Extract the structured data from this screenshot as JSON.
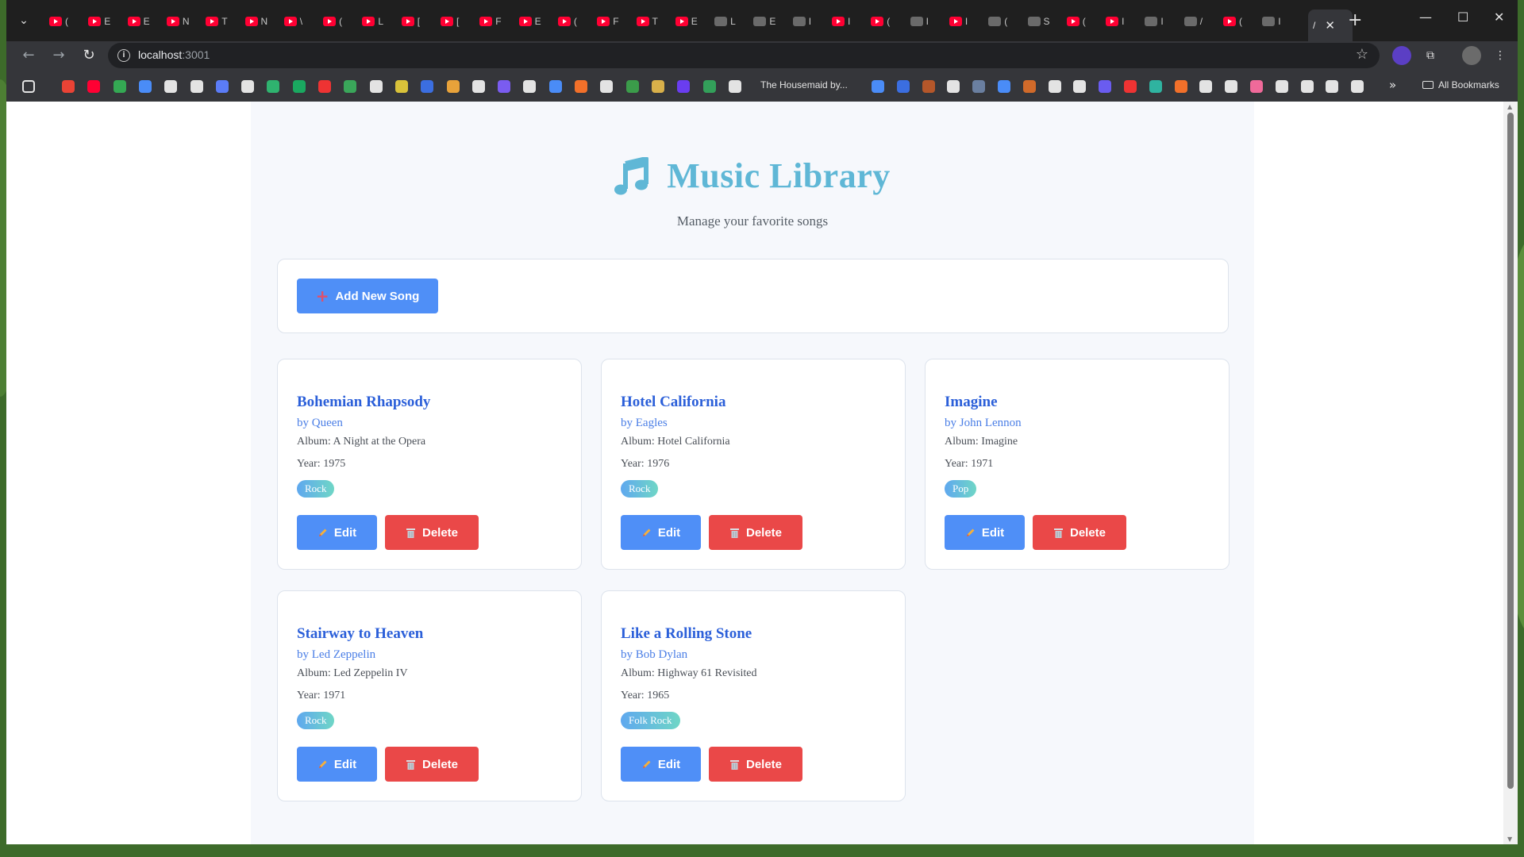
{
  "browser": {
    "tabs": [
      {
        "text": "(",
        "kind": "youtube"
      },
      {
        "text": "E",
        "kind": "youtube"
      },
      {
        "text": "E",
        "kind": "youtube"
      },
      {
        "text": "N",
        "kind": "youtube"
      },
      {
        "text": "T",
        "kind": "youtube"
      },
      {
        "text": "N",
        "kind": "youtube"
      },
      {
        "text": "\\",
        "kind": "youtube"
      },
      {
        "text": "(",
        "kind": "youtube"
      },
      {
        "text": "L",
        "kind": "youtube"
      },
      {
        "text": "[",
        "kind": "youtube"
      },
      {
        "text": "[",
        "kind": "youtube"
      },
      {
        "text": "F",
        "kind": "youtube"
      },
      {
        "text": "E",
        "kind": "youtube"
      },
      {
        "text": "(",
        "kind": "youtube"
      },
      {
        "text": "F",
        "kind": "youtube"
      },
      {
        "text": "T",
        "kind": "youtube"
      },
      {
        "text": "E",
        "kind": "youtube"
      },
      {
        "text": "L",
        "kind": "site"
      },
      {
        "text": "E",
        "kind": "site"
      },
      {
        "text": "I",
        "kind": "site"
      },
      {
        "text": "I",
        "kind": "youtube"
      },
      {
        "text": "(",
        "kind": "youtube"
      },
      {
        "text": "I",
        "kind": "site"
      },
      {
        "text": "I",
        "kind": "youtube"
      },
      {
        "text": "(",
        "kind": "site"
      },
      {
        "text": "S",
        "kind": "site"
      },
      {
        "text": "(",
        "kind": "youtube"
      },
      {
        "text": "I",
        "kind": "youtube"
      },
      {
        "text": "I",
        "kind": "site"
      },
      {
        "text": "/",
        "kind": "site"
      },
      {
        "text": "(",
        "kind": "youtube"
      },
      {
        "text": "I",
        "kind": "site"
      }
    ],
    "active_tab": {
      "text": "/",
      "close": "✕"
    },
    "new_tab": "+",
    "window_controls": {
      "minimize": "—",
      "maximize": "☐",
      "close": "✕"
    },
    "url_host": "localhost",
    "url_port": ":3001",
    "bookmark_text": "The Housemaid by...",
    "bookmarks_more": "»",
    "all_bookmarks": "All Bookmarks"
  },
  "app": {
    "title": "Music Library",
    "subtitle": "Manage your favorite songs",
    "add_button": "Add New Song",
    "edit_label": "Edit",
    "delete_label": "Delete",
    "accent_color": "#4f8ff7",
    "danger_color": "#ea4848",
    "songs": [
      {
        "title": "Bohemian Rhapsody",
        "artist": "by Queen",
        "album": "Album: A Night at the Opera",
        "year": "Year: 1975",
        "genre": "Rock"
      },
      {
        "title": "Hotel California",
        "artist": "by Eagles",
        "album": "Album: Hotel California",
        "year": "Year: 1976",
        "genre": "Rock"
      },
      {
        "title": "Imagine",
        "artist": "by John Lennon",
        "album": "Album: Imagine",
        "year": "Year: 1971",
        "genre": "Pop"
      },
      {
        "title": "Stairway to Heaven",
        "artist": "by Led Zeppelin",
        "album": "Album: Led Zeppelin IV",
        "year": "Year: 1971",
        "genre": "Rock"
      },
      {
        "title": "Like a Rolling Stone",
        "artist": "by Bob Dylan",
        "album": "Album: Highway 61 Revisited",
        "year": "Year: 1965",
        "genre": "Folk Rock"
      }
    ]
  }
}
